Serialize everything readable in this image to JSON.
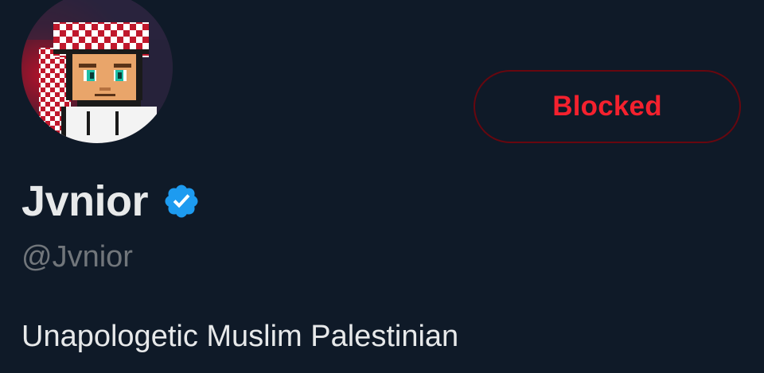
{
  "profile": {
    "display_name": "Jvnior",
    "handle": "@Jvnior",
    "bio": "Unapologetic Muslim Palestinian",
    "verified": true
  },
  "actions": {
    "block_state_label": "Blocked"
  },
  "icons": {
    "verified": "verified-badge-icon",
    "avatar": "pixel-art-avatar-keffiyeh"
  },
  "colors": {
    "background": "#0f1a28",
    "blocked_text": "#f4212e",
    "blocked_border": "#67070f",
    "verified_badge": "#1d9bf0",
    "handle_text": "#71767b",
    "primary_text": "#e7e9ea"
  }
}
